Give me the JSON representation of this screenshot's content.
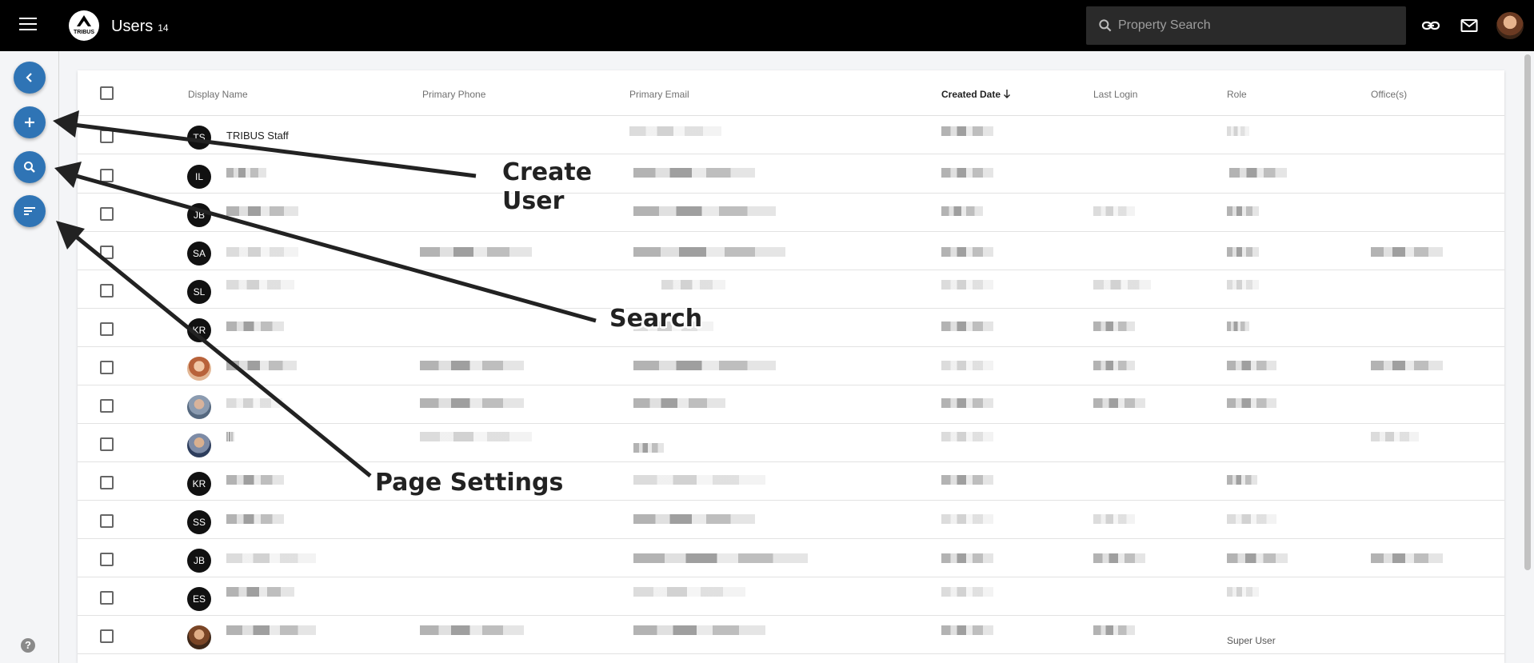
{
  "header": {
    "logo_text": "TRIBUS",
    "title": "Users",
    "count": "14",
    "search_placeholder": "Property Search",
    "icons": [
      "menu-icon",
      "search-icon",
      "link-icon",
      "mail-icon",
      "avatar"
    ]
  },
  "sidebar": {
    "buttons": [
      "back-chevron-icon",
      "add-icon",
      "search-icon",
      "filter-sort-icon"
    ],
    "help_label": "?"
  },
  "table": {
    "columns": [
      "Display Name",
      "Primary Phone",
      "Primary Email",
      "Created Date",
      "Last Login",
      "Role",
      "Office(s)"
    ],
    "sorted_column": "Created Date",
    "sort_direction": "descending",
    "rows": [
      {
        "initials": "TS",
        "name": "TRIBUS Staff"
      },
      {
        "initials": "IL",
        "name": ""
      },
      {
        "initials": "JB",
        "name": ""
      },
      {
        "initials": "SA",
        "name": ""
      },
      {
        "initials": "SL",
        "name": ""
      },
      {
        "initials": "KR",
        "name": ""
      },
      {
        "initials": "",
        "name": ""
      },
      {
        "initials": "",
        "name": ""
      },
      {
        "initials": "",
        "name": ""
      },
      {
        "initials": "KR",
        "name": ""
      },
      {
        "initials": "SS",
        "name": ""
      },
      {
        "initials": "JB",
        "name": ""
      },
      {
        "initials": "ES",
        "name": ""
      },
      {
        "initials": "",
        "name": "",
        "role": "Super User"
      }
    ]
  },
  "annotations": {
    "create_user_line1": "Create",
    "create_user_line2": "User",
    "search": "Search",
    "page_settings": "Page Settings"
  },
  "colors": {
    "topbar": "#000000",
    "fab": "#2f74b5",
    "background": "#f4f5f7"
  }
}
